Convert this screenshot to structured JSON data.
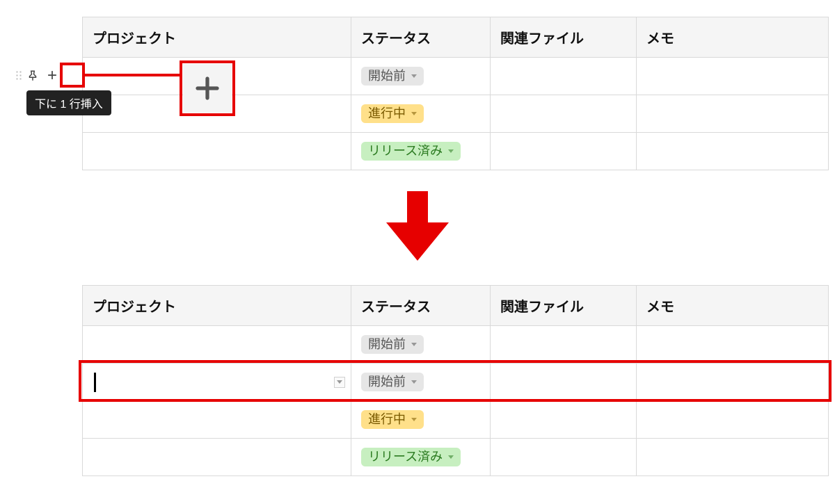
{
  "columns": {
    "project": "プロジェクト",
    "status": "ステータス",
    "file": "関連ファイル",
    "memo": "メモ"
  },
  "statuses": {
    "not_started": "開始前",
    "in_progress": "進行中",
    "released": "リリース済み"
  },
  "tooltip": {
    "insert_below": "下に 1 行挿入"
  },
  "table_before": {
    "rows": [
      {
        "project": "",
        "status_key": "not_started"
      },
      {
        "project": "",
        "status_key": "in_progress"
      },
      {
        "project": "",
        "status_key": "released"
      }
    ]
  },
  "table_after": {
    "rows": [
      {
        "project": "",
        "status_key": "not_started",
        "is_new": false
      },
      {
        "project": "",
        "status_key": "not_started",
        "is_new": true
      },
      {
        "project": "",
        "status_key": "in_progress",
        "is_new": false
      },
      {
        "project": "",
        "status_key": "released",
        "is_new": false
      }
    ]
  },
  "annotation": {
    "highlight_color": "#e60000"
  }
}
